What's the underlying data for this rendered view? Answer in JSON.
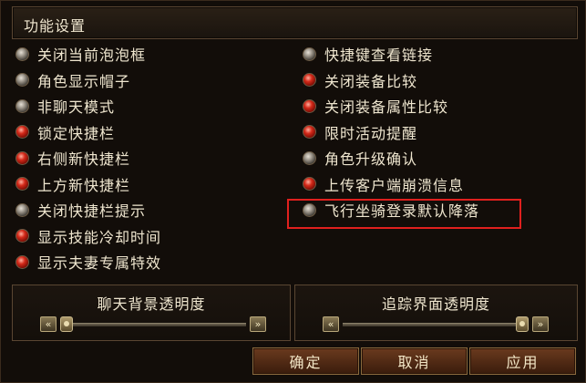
{
  "window": {
    "title": "功能设置"
  },
  "options": {
    "left": [
      {
        "label": "关闭当前泡泡框",
        "state": "off"
      },
      {
        "label": "角色显示帽子",
        "state": "off"
      },
      {
        "label": "非聊天模式",
        "state": "off"
      },
      {
        "label": "锁定快捷栏",
        "state": "on"
      },
      {
        "label": "右侧新快捷栏",
        "state": "on"
      },
      {
        "label": "上方新快捷栏",
        "state": "on"
      },
      {
        "label": "关闭快捷栏提示",
        "state": "off"
      },
      {
        "label": "显示技能冷却时间",
        "state": "on"
      },
      {
        "label": "显示夫妻专属特效",
        "state": "on"
      }
    ],
    "right": [
      {
        "label": "快捷键查看链接",
        "state": "off"
      },
      {
        "label": "关闭装备比较",
        "state": "on"
      },
      {
        "label": "关闭装备属性比较",
        "state": "on"
      },
      {
        "label": "限时活动提醒",
        "state": "on"
      },
      {
        "label": "角色升级确认",
        "state": "off"
      },
      {
        "label": "上传客户端崩溃信息",
        "state": "on"
      },
      {
        "label": "飞行坐骑登录默认降落",
        "state": "off"
      }
    ]
  },
  "sliders": {
    "chat_bg": {
      "label": "聊天背景透明度",
      "value": 0.0
    },
    "tracking": {
      "label": "追踪界面透明度",
      "value": 1.0
    }
  },
  "buttons": {
    "ok": "确定",
    "cancel": "取消",
    "apply": "应用"
  },
  "icons": {
    "slider_left": "«",
    "slider_right": "»"
  },
  "colors": {
    "radio_on": "#d42a1a",
    "radio_off": "#9c958a",
    "highlight": "#e0201e"
  }
}
